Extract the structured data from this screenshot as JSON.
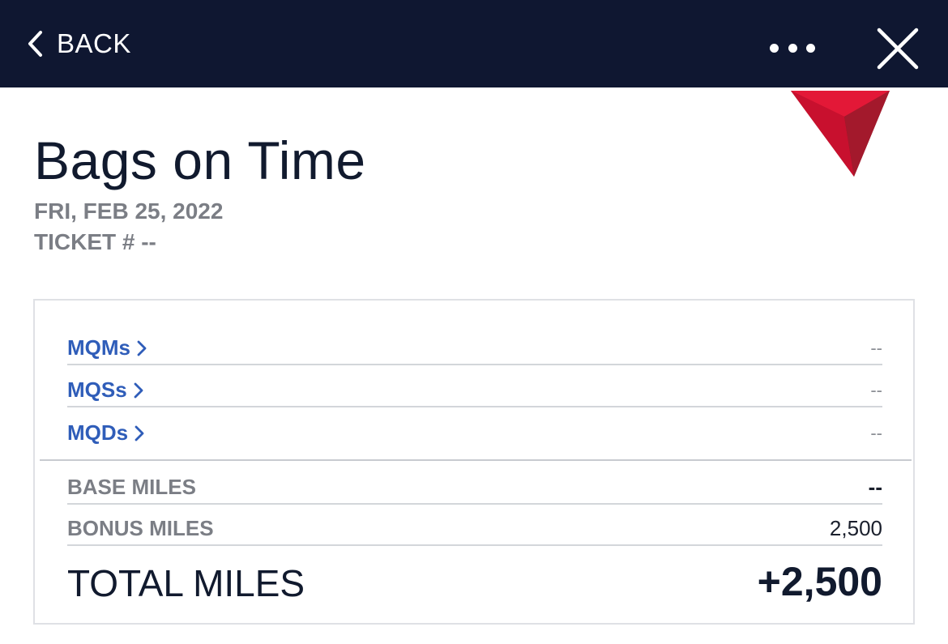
{
  "header": {
    "back_label": "BACK",
    "more_icon": "more-horizontal-icon",
    "close_icon": "close-icon",
    "background_color": "#0f1731"
  },
  "brand": {
    "logo_icon": "delta-widget-logo",
    "logo_colors": [
      "#e31837",
      "#b51a2f",
      "#8c1526"
    ]
  },
  "page": {
    "title": "Bags on Time",
    "date": "FRI, FEB 25, 2022",
    "ticket": "TICKET # --"
  },
  "qualifying": [
    {
      "label": "MQMs",
      "value": "--"
    },
    {
      "label": "MQSs",
      "value": "--"
    },
    {
      "label": "MQDs",
      "value": "--"
    }
  ],
  "miles": {
    "base_label": "BASE MILES",
    "base_value": "--",
    "bonus_label": "BONUS MILES",
    "bonus_value": "2,500",
    "total_label": "TOTAL MILES",
    "total_value": "+2,500"
  },
  "colors": {
    "link": "#2f5db9",
    "muted": "#7b7e85",
    "text": "#111a2e"
  }
}
